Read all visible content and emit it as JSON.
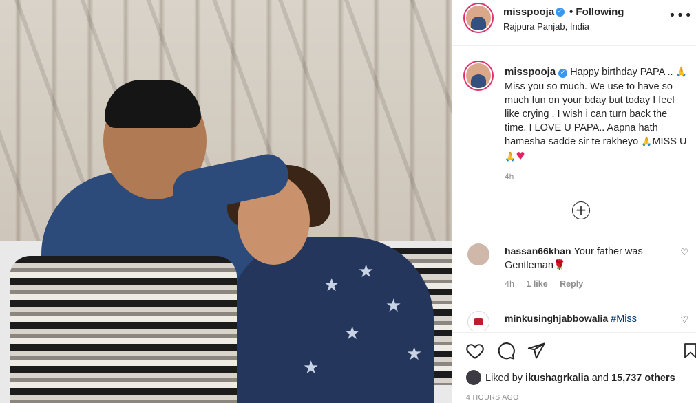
{
  "post": {
    "username": "misspooja",
    "follow_status": "• Following",
    "location": "Rajpura Panjab, India",
    "caption": {
      "username": "misspooja",
      "line_a": "Happy birthday PAPA ..",
      "line_b": "Miss you so much. We use to have so much fun on your bday but today I feel like crying . I wish i can turn back the time. I LOVE U PAPA.. Aapna hath hamesha sadde sir te rakheyo",
      "line_c": "MISS U",
      "time": "4h"
    },
    "comments": [
      {
        "username": "hassan66khan",
        "text": "Your father was Gentleman🌹",
        "time": "4h",
        "likes": "1 like",
        "reply": "Reply"
      },
      {
        "username": "minkusinghjabbowalia",
        "hashtag": "#Miss"
      }
    ],
    "likes": {
      "prefix": "Liked by",
      "user": "ikushagrkalia",
      "joiner": "and",
      "count_text": "15,737 others"
    },
    "timestamp": "4 HOURS AGO"
  },
  "icons": {
    "more": "more-options-icon",
    "verified": "verified-badge-icon",
    "load_more": "plus-circle-icon",
    "like": "heart-icon",
    "comment": "comment-icon",
    "share": "paper-plane-icon",
    "save": "bookmark-icon"
  },
  "colors": {
    "verified": "#3897f0",
    "story_ring": "#e1306c",
    "muted": "#8e8e8e",
    "hashtag": "#00376b"
  }
}
